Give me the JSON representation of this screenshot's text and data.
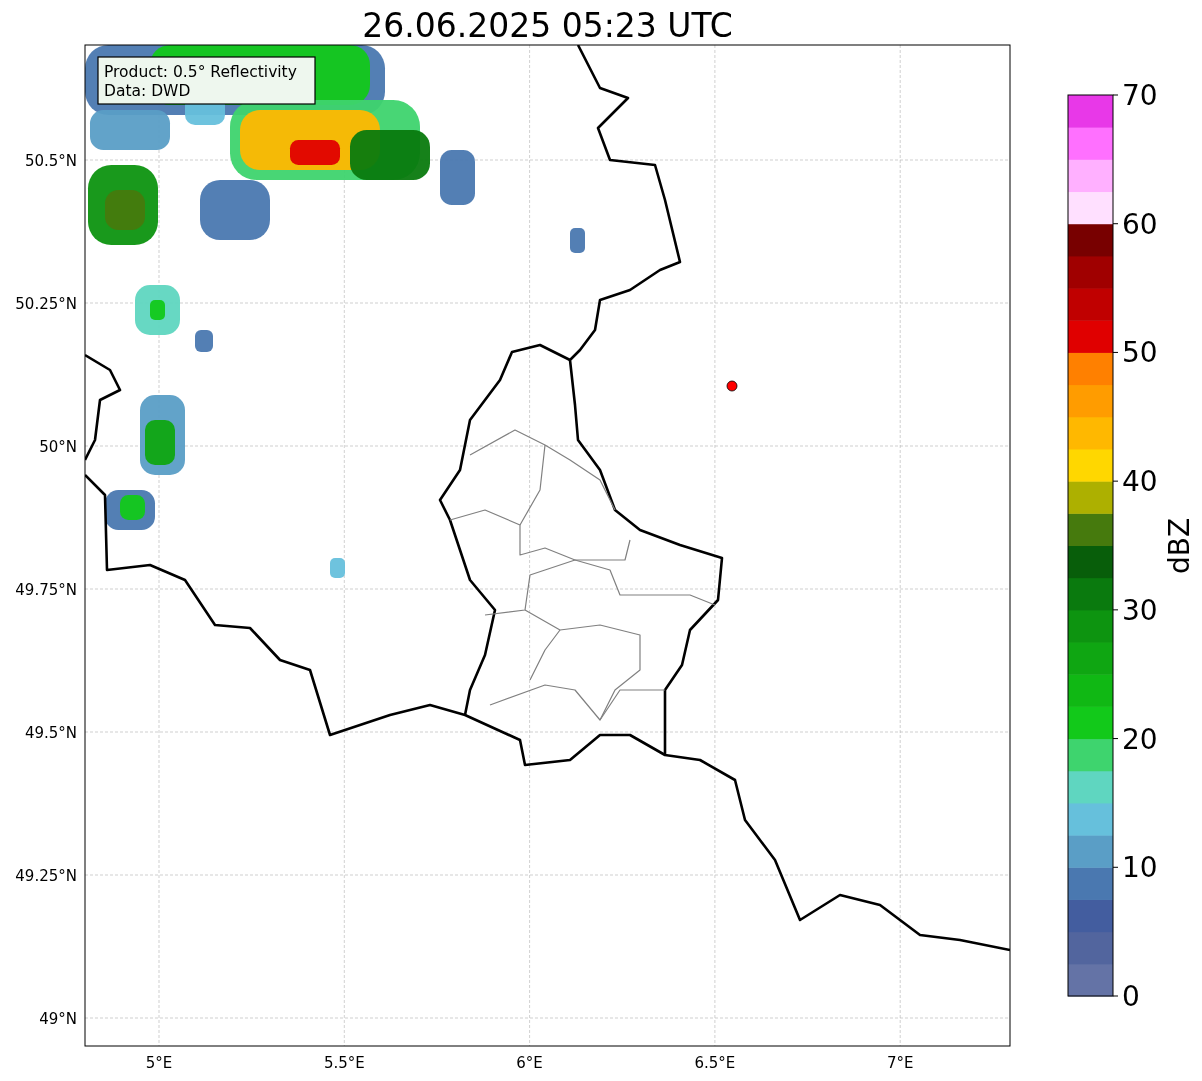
{
  "title": "26.06.2025 05:23 UTC",
  "map": {
    "info_box": [
      "Product: 0.5° Reflectivity",
      "Data: DWD"
    ],
    "lat_labels": [
      "50.5°N",
      "50.25°N",
      "50°N",
      "49.75°N",
      "49.5°N",
      "49.25°N",
      "49°N"
    ],
    "lon_labels": [
      "5°E",
      "5.5°E",
      "6°E",
      "6.5°E",
      "7°E"
    ]
  },
  "colorbar": {
    "label": "dBZ",
    "ticks": [
      "70",
      "60",
      "50",
      "40",
      "30",
      "20",
      "10",
      "0"
    ],
    "segments": [
      {
        "color": "#6473a6"
      },
      {
        "color": "#52659e"
      },
      {
        "color": "#435d9f"
      },
      {
        "color": "#4a78b0"
      },
      {
        "color": "#5a9ec6"
      },
      {
        "color": "#66c0dc"
      },
      {
        "color": "#5fd6c0"
      },
      {
        "color": "#3ed46e"
      },
      {
        "color": "#12c91a"
      },
      {
        "color": "#10b814"
      },
      {
        "color": "#0fa612"
      },
      {
        "color": "#0d9410"
      },
      {
        "color": "#0a7a0e"
      },
      {
        "color": "#085e0a"
      },
      {
        "color": "#467a0d"
      },
      {
        "color": "#adb000"
      },
      {
        "color": "#ffd700"
      },
      {
        "color": "#ffb800"
      },
      {
        "color": "#ff9c00"
      },
      {
        "color": "#ff8000"
      },
      {
        "color": "#e00000"
      },
      {
        "color": "#c00000"
      },
      {
        "color": "#a00000"
      },
      {
        "color": "#780000"
      },
      {
        "color": "#ffe0ff"
      },
      {
        "color": "#ffb0ff"
      },
      {
        "color": "#ff70ff"
      },
      {
        "color": "#e838e8"
      }
    ]
  }
}
